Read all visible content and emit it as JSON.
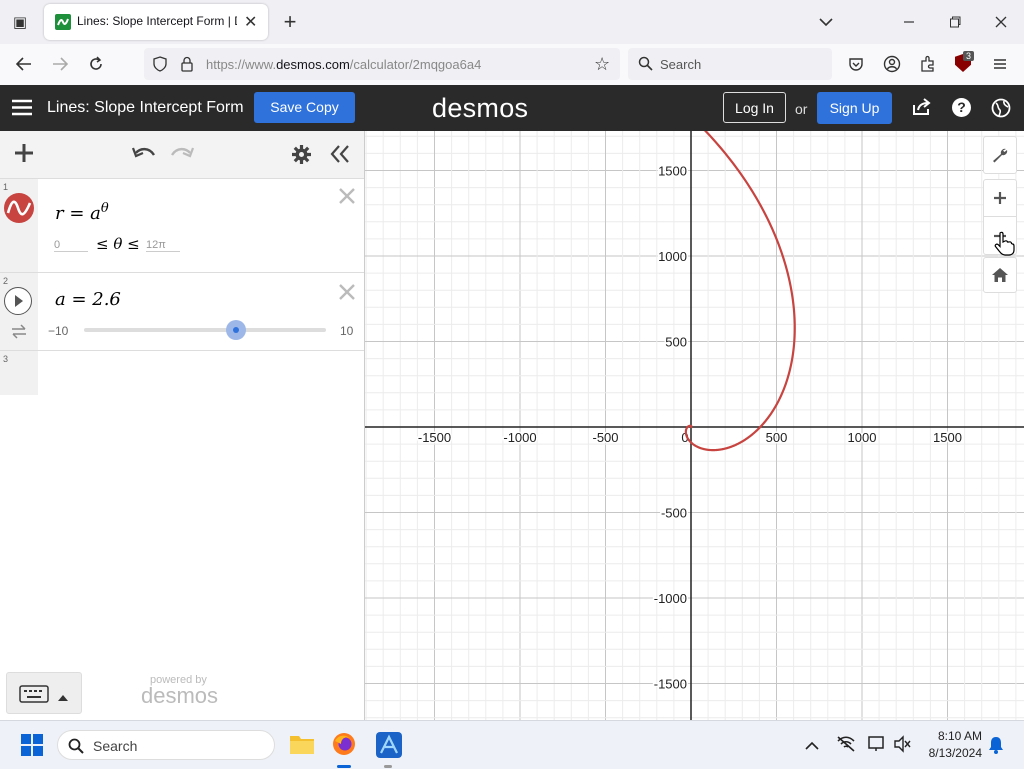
{
  "browser": {
    "tab_title": "Lines: Slope Intercept Form | De",
    "url_prefix": "https://www.",
    "url_domain": "desmos.com",
    "url_path": "/calculator/2mqgoa6a4",
    "search_placeholder": "Search",
    "extension_badge": "3"
  },
  "header": {
    "graph_title": "Lines: Slope Intercept Form",
    "save_copy": "Save Copy",
    "logo": "desmos",
    "log_in": "Log In",
    "or": "or",
    "sign_up": "Sign Up"
  },
  "expressions": [
    {
      "line": "1",
      "formula_lhs": "r = a",
      "formula_exp": "θ",
      "domain_min": "0",
      "domain_mid": "≤ θ ≤",
      "domain_max": "12π",
      "color": "#c74440"
    },
    {
      "line": "2",
      "formula": "a = 2.6",
      "slider_min": "−10",
      "slider_max": "10",
      "slider_value": 2.6
    },
    {
      "line": "3"
    }
  ],
  "powered_by": "powered by",
  "powered_logo": "desmos",
  "graph": {
    "x_ticks": [
      "-1500",
      "-1000",
      "-500",
      "0",
      "500",
      "1000",
      "1500"
    ],
    "y_ticks_pos": [
      "1500",
      "1000",
      "500"
    ],
    "y_ticks_neg": [
      "-500",
      "-1000",
      "-1500"
    ],
    "curve_color": "#c74440"
  },
  "taskbar": {
    "search_placeholder": "Search",
    "time": "8:10 AM",
    "date": "8/13/2024"
  },
  "icons": [
    "window-list-icon",
    "desmos-favicon-icon",
    "close-tab-icon",
    "new-tab-icon",
    "tab-list-icon",
    "minimize-icon",
    "maximize-icon",
    "close-window-icon",
    "back-icon",
    "forward-icon",
    "reload-icon",
    "shield-icon",
    "lock-icon",
    "bookmark-star-icon",
    "search-icon",
    "pocket-icon",
    "account-icon",
    "extensions-icon",
    "ublock-icon",
    "menu-icon",
    "hamburger-icon",
    "share-icon",
    "help-icon",
    "globe-icon",
    "add-icon",
    "undo-icon",
    "redo-icon",
    "gear-icon",
    "collapse-icon",
    "play-icon",
    "loop-icon",
    "keyboard-icon",
    "wrench-icon",
    "zoom-in-icon",
    "zoom-out-icon",
    "home-icon",
    "windows-icon",
    "file-explorer-icon",
    "firefox-icon",
    "affinity-icon"
  ]
}
